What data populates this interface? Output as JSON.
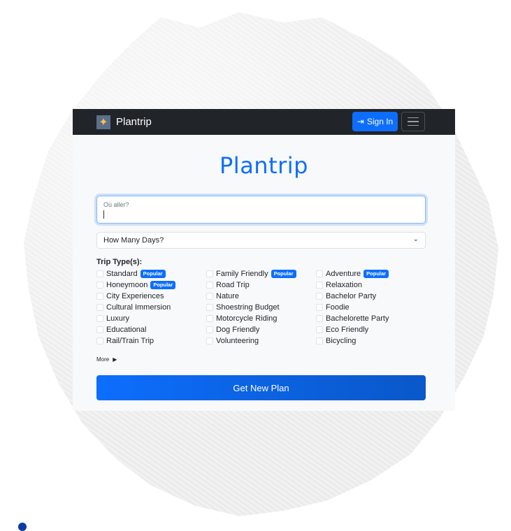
{
  "navbar": {
    "brand": "Plantrip",
    "brand_icon": "compass-icon",
    "signin_label": "Sign In"
  },
  "main": {
    "title": "Plantrip",
    "where_placeholder": "Où aller?",
    "days_select": "How Many Days?",
    "trip_types_label": "Trip Type(s):",
    "badge_text": "Popular",
    "trip_types": [
      {
        "label": "Standard",
        "popular": true
      },
      {
        "label": "Family Friendly",
        "popular": true
      },
      {
        "label": "Adventure",
        "popular": true
      },
      {
        "label": "Honeymoon",
        "popular": true
      },
      {
        "label": "Road Trip",
        "popular": false
      },
      {
        "label": "Relaxation",
        "popular": false
      },
      {
        "label": "City Experiences",
        "popular": false
      },
      {
        "label": "Nature",
        "popular": false
      },
      {
        "label": "Bachelor Party",
        "popular": false
      },
      {
        "label": "Cultural Immersion",
        "popular": false
      },
      {
        "label": "Shoestring Budget",
        "popular": false
      },
      {
        "label": "Foodie",
        "popular": false
      },
      {
        "label": "Luxury",
        "popular": false
      },
      {
        "label": "Motorcycle Riding",
        "popular": false
      },
      {
        "label": "Bachelorette Party",
        "popular": false
      },
      {
        "label": "Educational",
        "popular": false
      },
      {
        "label": "Dog Friendly",
        "popular": false
      },
      {
        "label": "Eco Friendly",
        "popular": false
      },
      {
        "label": "Rail/Train Trip",
        "popular": false
      },
      {
        "label": "Volunteering",
        "popular": false
      },
      {
        "label": "Bicycling",
        "popular": false
      }
    ],
    "more_label": "More",
    "submit_label": "Get New Plan"
  },
  "colors": {
    "primary": "#0d6efd",
    "navbar": "#212529"
  }
}
